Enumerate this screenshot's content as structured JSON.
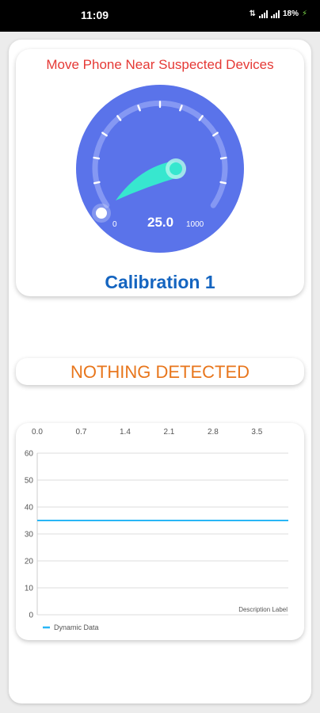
{
  "status_bar": {
    "time": "11:09",
    "battery": "18%",
    "icons": [
      "data-indicator-icon",
      "signal-icon",
      "signal-icon",
      "battery-charging-icon"
    ]
  },
  "gauge": {
    "hint": "Move Phone Near Suspected Devices",
    "value": "25.0",
    "min_label": "0",
    "max_label": "1000",
    "calibration": "Calibration 1",
    "colors": {
      "dial": "#5a73ea",
      "ring": "#8598f3",
      "needle": "#37e7cf"
    }
  },
  "detection": {
    "status": "NOTHING DETECTED",
    "color": "#e8761c"
  },
  "chart_data": {
    "type": "line",
    "x_ticks": [
      "0.0",
      "0.7",
      "1.4",
      "2.1",
      "2.8",
      "3.5"
    ],
    "y_ticks": [
      "0",
      "10",
      "20",
      "30",
      "40",
      "50",
      "60"
    ],
    "xlim": [
      0,
      4
    ],
    "ylim": [
      0,
      60
    ],
    "x_axis_position": "top",
    "grid": true,
    "legend_position": "bottom-left",
    "description": "Description Label",
    "series": [
      {
        "name": "Dynamic Data",
        "x": [
          0,
          4
        ],
        "values": [
          35,
          35
        ],
        "color": "#29b6f6"
      }
    ]
  }
}
